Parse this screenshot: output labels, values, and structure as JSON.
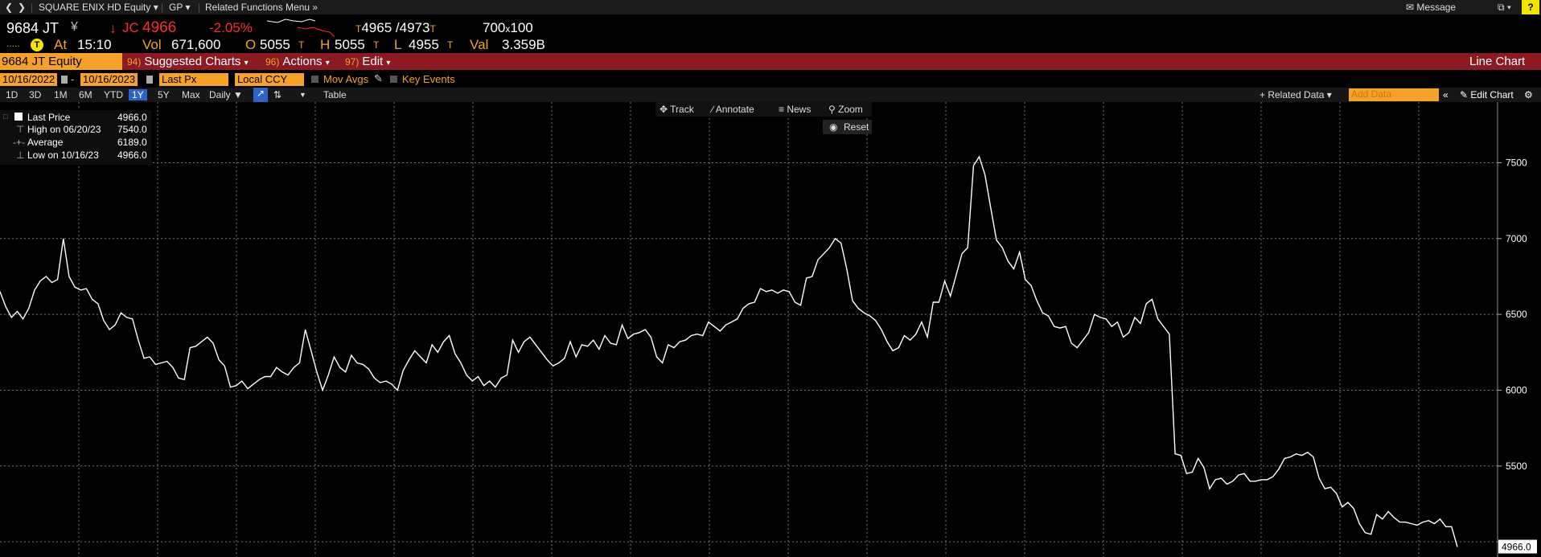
{
  "nav": {
    "security": "SQUARE ENIX HD Equity",
    "function": "GP",
    "related": "Related Functions Menu",
    "message": "Message",
    "help": "?"
  },
  "quote": {
    "ticker": "9684 JT",
    "currency_symbol": "¥",
    "last_prefix": "JC",
    "last": "4966",
    "change_pct": "-2.05%",
    "bid": "4965",
    "ask": "4973",
    "size_bid": "700",
    "size_ask": "100",
    "at_label": "At",
    "time": "15:10",
    "vol_label": "Vol",
    "vol": "671,600",
    "open_label": "O",
    "open": "5055",
    "high_label": "H",
    "high": "5055",
    "low_label": "L",
    "low": "4955",
    "val_label": "Val",
    "val": "3.359B"
  },
  "toolbar": {
    "ticker_field": "9684 JT Equity",
    "suggested_num": "94)",
    "suggested": "Suggested Charts",
    "actions_num": "96)",
    "actions": "Actions",
    "edit_num": "97)",
    "edit": "Edit",
    "chart_type": "Line Chart"
  },
  "options": {
    "start_date": "10/16/2022",
    "end_date": "10/16/2023",
    "field": "Last Px",
    "ccy": "Local CCY",
    "mov_avgs": "Mov Avgs",
    "key_events": "Key Events"
  },
  "ranges": [
    "1D",
    "3D",
    "1M",
    "6M",
    "YTD",
    "1Y",
    "5Y",
    "Max"
  ],
  "active_range": "1Y",
  "period": "Daily",
  "table_label": "Table",
  "related_data": "Related Data",
  "add_data_placeholder": "Add Data",
  "edit_chart": "Edit Chart",
  "chart_tools": {
    "track": "Track",
    "annotate": "Annotate",
    "news": "News",
    "zoom": "Zoom",
    "reset": "Reset"
  },
  "legend": {
    "last_price_label": "Last Price",
    "last_price": "4966.0",
    "high_label": "High on 06/20/23",
    "high": "7540.0",
    "average_label": "Average",
    "average": "6189.0",
    "low_label": "Low on 10/16/23",
    "low": "4966.0"
  },
  "colors": {
    "accent": "#f5a12a",
    "band": "#8b1a22",
    "down": "#ff2b2b",
    "active_tab": "#2e63c7"
  },
  "chart_data": {
    "type": "line",
    "ylim": [
      4900,
      7900
    ],
    "yticks": [
      5000,
      5500,
      6000,
      6500,
      7000,
      7500
    ],
    "ytick_labels": [
      "",
      "5500",
      "6000",
      "6500",
      "7000",
      "7500"
    ],
    "last_value_label": "4966.0",
    "grid": true,
    "series": [
      {
        "values": [
          6650,
          6550,
          6480,
          6520,
          6470,
          6540,
          6660,
          6720,
          6750,
          6710,
          6730,
          7000,
          6750,
          6680,
          6660,
          6670,
          6600,
          6570,
          6460,
          6400,
          6430,
          6510,
          6480,
          6470,
          6330,
          6210,
          6220,
          6170,
          6180,
          6190,
          6150,
          6080,
          6070,
          6280,
          6290,
          6320,
          6350,
          6310,
          6200,
          6160,
          6020,
          6030,
          6060,
          6010,
          6040,
          6070,
          6090,
          6090,
          6150,
          6120,
          6100,
          6150,
          6180,
          6400,
          6260,
          6120,
          6000,
          6100,
          6220,
          6150,
          6120,
          6230,
          6180,
          6170,
          6140,
          6080,
          6050,
          6060,
          6040,
          6000,
          6130,
          6200,
          6260,
          6220,
          6180,
          6300,
          6250,
          6320,
          6360,
          6240,
          6180,
          6100,
          6060,
          6090,
          6030,
          6060,
          6020,
          6080,
          6100,
          6330,
          6250,
          6320,
          6350,
          6300,
          6250,
          6200,
          6160,
          6180,
          6210,
          6320,
          6220,
          6300,
          6290,
          6330,
          6270,
          6360,
          6310,
          6300,
          6430,
          6340,
          6370,
          6380,
          6400,
          6350,
          6220,
          6180,
          6300,
          6280,
          6320,
          6330,
          6360,
          6370,
          6360,
          6450,
          6420,
          6390,
          6430,
          6450,
          6470,
          6540,
          6570,
          6580,
          6670,
          6650,
          6660,
          6640,
          6660,
          6650,
          6580,
          6560,
          6740,
          6750,
          6860,
          6900,
          6940,
          7000,
          6970,
          6800,
          6590,
          6540,
          6510,
          6490,
          6460,
          6400,
          6320,
          6260,
          6280,
          6360,
          6330,
          6370,
          6450,
          6350,
          6580,
          6580,
          6720,
          6620,
          6760,
          6900,
          6940,
          7480,
          7540,
          7420,
          7200,
          6990,
          6940,
          6850,
          6800,
          6910,
          6730,
          6690,
          6590,
          6510,
          6490,
          6420,
          6410,
          6420,
          6310,
          6280,
          6330,
          6380,
          6500,
          6480,
          6470,
          6420,
          6450,
          6350,
          6380,
          6480,
          6440,
          6570,
          6600,
          6470,
          6420,
          6370,
          5580,
          5570,
          5450,
          5460,
          5550,
          5490,
          5350,
          5410,
          5420,
          5380,
          5400,
          5440,
          5450,
          5400,
          5400,
          5410,
          5410,
          5430,
          5480,
          5550,
          5560,
          5580,
          5570,
          5590,
          5560,
          5420,
          5350,
          5360,
          5320,
          5230,
          5260,
          5220,
          5120,
          5060,
          5050,
          5180,
          5150,
          5200,
          5160,
          5130,
          5130,
          5120,
          5110,
          5130,
          5140,
          5120,
          5150,
          5100,
          5100,
          4966
        ]
      }
    ]
  }
}
